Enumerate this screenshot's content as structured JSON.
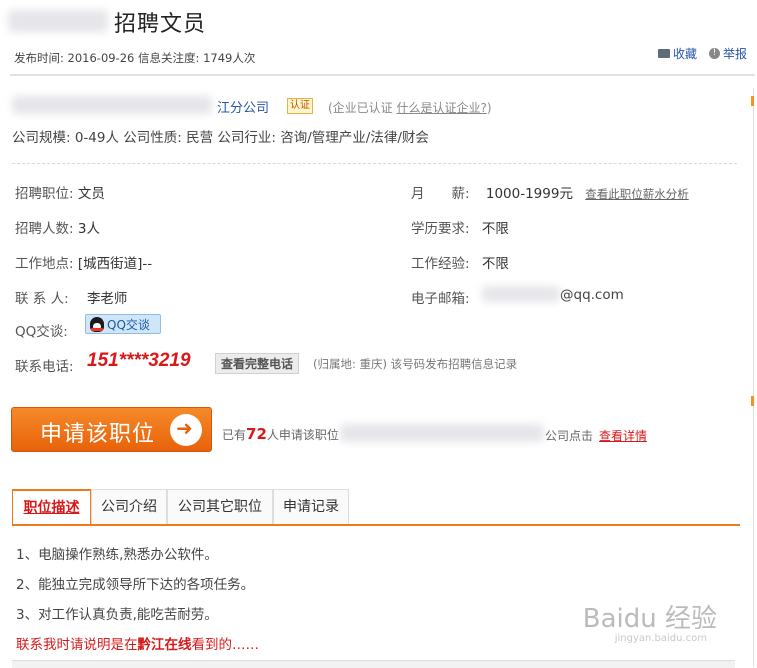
{
  "title": "招聘文员",
  "meta": {
    "publish_label": "发布时间:",
    "publish_date": "2016-09-26",
    "attention_label": "信息关注度:",
    "attention_value": "1749人次"
  },
  "top_links": {
    "favorite": "收藏",
    "report": "举报"
  },
  "company": {
    "name_visible": "江分公司",
    "cert_badge": "认证",
    "cert_note_prefix": "(企业已认证 ",
    "cert_link": "什么是认证企业?",
    "cert_note_suffix": ")",
    "info": "公司规模: 0-49人 公司性质: 民营 公司行业: 咨询/管理产业/法律/财会"
  },
  "job": {
    "position_label": "招聘职位:",
    "position": "文员",
    "count_label": "招聘人数:",
    "count": "3人",
    "location_label": "工作地点:",
    "location": "[城西街道]--",
    "contact_label": "联 系 人:",
    "contact": "李老师",
    "qq_label": "QQ交谈:",
    "qq_button": "QQ交谈",
    "salary_label": "月　　薪:",
    "salary": "1000-1999元",
    "salary_link": "查看此职位薪水分析",
    "education_label": "学历要求:",
    "education": "不限",
    "experience_label": "工作经验:",
    "experience": "不限",
    "email_label": "电子邮箱:",
    "email_visible": "@qq.com",
    "phone_label": "联系电话:",
    "phone": "151****3219",
    "view_phone": "查看完整电话",
    "phone_note": "(归属地: 重庆) 该号码发布招聘信息记录"
  },
  "apply": {
    "button": "申请该职位",
    "applied_prefix": "已有",
    "applied_count": "72",
    "applied_mid": "人申请该职位",
    "applied_tail": "公司点击",
    "detail_link": "查看详情"
  },
  "tabs": [
    "职位描述",
    "公司介绍",
    "公司其它职位",
    "申请记录"
  ],
  "description": [
    "1、电脑操作熟练,熟悉办公软件。",
    "2、能独立完成领导所下达的各项任务。",
    "3、对工作认真负责,能吃苦耐劳。"
  ],
  "contact_tip": {
    "prefix": "联系我时请说明是在",
    "site": "黔江在线",
    "suffix": "看到的……"
  },
  "watermark": {
    "brand": "Baidu 经验",
    "url": "jingyan.baidu.com"
  },
  "colors": {
    "accent": "#f07a1a",
    "link": "#2755a8",
    "red": "#d7191a"
  }
}
